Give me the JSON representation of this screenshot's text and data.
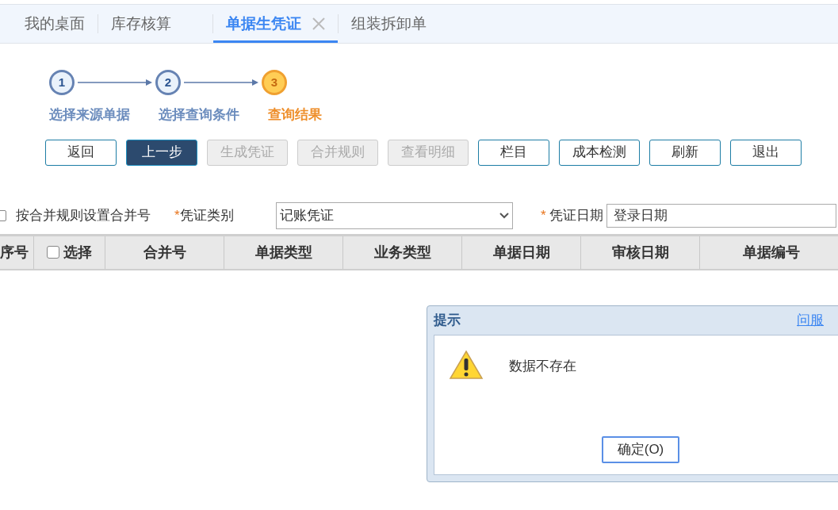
{
  "tabs": [
    {
      "label": "我的桌面",
      "selected": false,
      "closable": false
    },
    {
      "label": "库存核算",
      "selected": false,
      "closable": false
    },
    {
      "label": "单据生凭证",
      "selected": true,
      "closable": true
    },
    {
      "label": "组装拆卸单",
      "selected": false,
      "closable": false
    }
  ],
  "steps": [
    {
      "number": "1",
      "label": "选择来源单据",
      "current": false
    },
    {
      "number": "2",
      "label": "选择查询条件",
      "current": false
    },
    {
      "number": "3",
      "label": "查询结果",
      "current": true
    }
  ],
  "toolbar": [
    {
      "label": "返回",
      "kind": "outline",
      "disabled": false
    },
    {
      "label": "上一步",
      "kind": "primary",
      "disabled": false
    },
    {
      "label": "生成凭证",
      "kind": "outline",
      "disabled": true
    },
    {
      "label": "合并规则",
      "kind": "outline",
      "disabled": true
    },
    {
      "label": "查看明细",
      "kind": "outline",
      "disabled": true
    },
    {
      "label": "栏目",
      "kind": "outline",
      "disabled": false
    },
    {
      "label": "成本检测",
      "kind": "outline",
      "disabled": false
    },
    {
      "label": "刷新",
      "kind": "outline",
      "disabled": false
    },
    {
      "label": "退出",
      "kind": "outline",
      "disabled": false
    }
  ],
  "merge_option": {
    "label": "按合并规则设置合并号",
    "checked": false
  },
  "voucher_type": {
    "required_mark": "*",
    "label": "凭证类别",
    "value": "记账凭证"
  },
  "voucher_date": {
    "required_mark": "*",
    "label": "凭证日期",
    "value": "登录日期"
  },
  "table": {
    "columns": [
      {
        "label": "序号",
        "kind": "text"
      },
      {
        "label": "选择",
        "kind": "checkbox",
        "checked": false
      },
      {
        "label": "合并号",
        "kind": "text"
      },
      {
        "label": "单据类型",
        "kind": "text"
      },
      {
        "label": "业务类型",
        "kind": "text"
      },
      {
        "label": "单据日期",
        "kind": "text"
      },
      {
        "label": "审核日期",
        "kind": "text"
      },
      {
        "label": "单据编号",
        "kind": "text"
      }
    ]
  },
  "dialog": {
    "title": "提示",
    "link": "问服",
    "message": "数据不存在",
    "button": "确定(O)"
  }
}
